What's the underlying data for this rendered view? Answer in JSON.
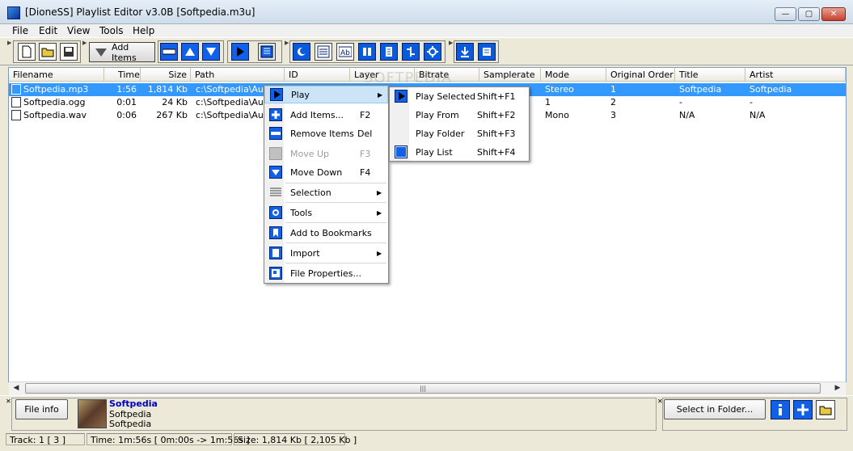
{
  "window": {
    "title": "[DioneSS] Playlist Editor v3.0B [Softpedia.m3u]",
    "min": "—",
    "max": "▢",
    "close": "✕"
  },
  "menubar": [
    "File",
    "Edit",
    "View",
    "Tools",
    "Help"
  ],
  "toolbar": {
    "add_items_label": "Add Items"
  },
  "columns": [
    "Filename",
    "Time",
    "Size",
    "Path",
    "ID",
    "Layer",
    "Bitrate",
    "Samplerate",
    "Mode",
    "Original Order",
    "Title",
    "Artist"
  ],
  "rows": [
    {
      "filename": "Softpedia.mp3",
      "time": "1:56",
      "size": "1,814 Kb",
      "path": "c:\\Softpedia\\Audi",
      "mode": "Stereo",
      "order": "1",
      "title": "Softpedia",
      "artist": "Softpedia",
      "selected": true
    },
    {
      "filename": "Softpedia.ogg",
      "time": "0:01",
      "size": "24 Kb",
      "path": "c:\\Softpedia\\Audi",
      "mode": "1",
      "order": "2",
      "title": "-",
      "artist": "-",
      "selected": false
    },
    {
      "filename": "Softpedia.wav",
      "time": "0:06",
      "size": "267 Kb",
      "path": "c:\\Softpedia\\Audi",
      "mode": "Mono",
      "order": "3",
      "title": "N/A",
      "artist": "N/A",
      "selected": false
    }
  ],
  "context_menu": [
    {
      "label": "Play",
      "shortcut": "",
      "submenu": true,
      "highlight": true,
      "disabled": false,
      "icon": "play-icon"
    },
    {
      "label": "Add Items...",
      "shortcut": "F2",
      "submenu": false,
      "disabled": false,
      "icon": "add-icon"
    },
    {
      "label": "Remove Items",
      "shortcut": "Del",
      "submenu": false,
      "disabled": false,
      "icon": "remove-icon"
    },
    {
      "label": "Move Up",
      "shortcut": "F3",
      "submenu": false,
      "disabled": true,
      "icon": "move-up-icon"
    },
    {
      "label": "Move Down",
      "shortcut": "F4",
      "submenu": false,
      "disabled": false,
      "icon": "move-down-icon"
    },
    {
      "label": "Selection",
      "shortcut": "",
      "submenu": true,
      "disabled": false,
      "icon": "selection-icon"
    },
    {
      "label": "Tools",
      "shortcut": "",
      "submenu": true,
      "disabled": false,
      "icon": "tools-icon"
    },
    {
      "label": "Add to Bookmarks",
      "shortcut": "",
      "submenu": false,
      "disabled": false,
      "icon": "bookmark-icon"
    },
    {
      "label": "Import",
      "shortcut": "",
      "submenu": true,
      "disabled": false,
      "icon": "import-icon"
    },
    {
      "label": "File Properties...",
      "shortcut": "",
      "submenu": false,
      "disabled": false,
      "icon": "properties-icon"
    }
  ],
  "play_submenu": [
    {
      "label": "Play Selected",
      "shortcut": "Shift+F1"
    },
    {
      "label": "Play From",
      "shortcut": "Shift+F2"
    },
    {
      "label": "Play Folder",
      "shortcut": "Shift+F3"
    },
    {
      "label": "Play List",
      "shortcut": "Shift+F4"
    }
  ],
  "watermark": "SOFTPEDIA",
  "bottom": {
    "file_info_button": "File info",
    "track_title": "Softpedia",
    "track_artist": "Softpedia",
    "track_album": "Softpedia",
    "select_in_folder_button": "Select in Folder..."
  },
  "status": {
    "track": "Track: 1 [ 3 ]",
    "time": "Time: 1m:56s  [ 0m:00s -> 1m:56s ]",
    "size": "Size: 1,814 Kb  [ 2,105 Kb ]"
  },
  "colors": {
    "selection": "#3399ff",
    "accent_blue": "#1060e8"
  }
}
